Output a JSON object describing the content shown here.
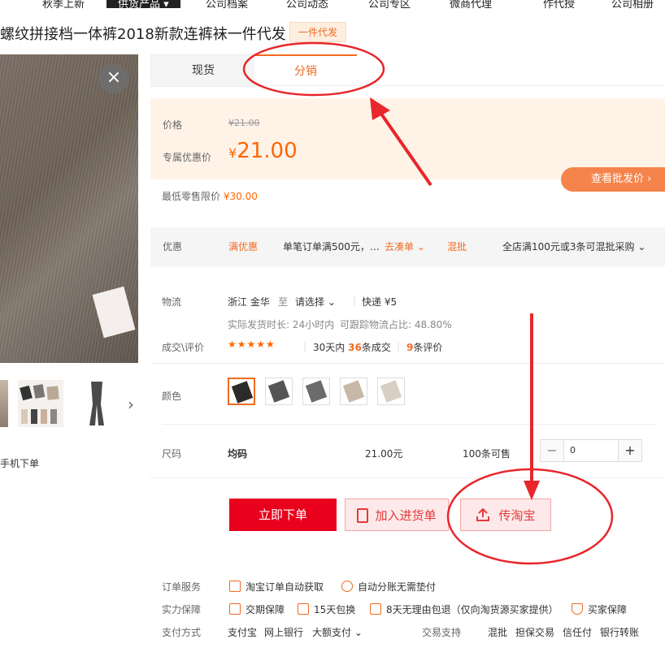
{
  "nav": {
    "items": [
      "秋季上新",
      "供货产品 ▾",
      "公司档案",
      "公司动态",
      "公司专区",
      "微商代理",
      "作代授",
      "公司相册"
    ]
  },
  "product": {
    "title": "螺纹拼接档一体裤2018新款连裤袜一件代发",
    "badge": "一件代发"
  },
  "gallery": {
    "close_symbol": "×",
    "mobile_order": "手机下单"
  },
  "tabs": {
    "spot": "现货",
    "distribution": "分销"
  },
  "price": {
    "price_label": "价格",
    "original": "¥21.00",
    "exclusive_label": "专属优惠价",
    "currency": "¥",
    "exclusive": "21.00",
    "view_wholesale": "查看批发价 ›",
    "min_retail_label": "最低零售限价",
    "min_retail": "¥30.00"
  },
  "promo": {
    "label": "优惠",
    "tag": "满优惠",
    "detail": "单笔订单满500元，…",
    "go_order": "去凑单 ⌄",
    "mix_tag": "混批",
    "mix_detail": "全店满100元或3条可混批采购 ⌄"
  },
  "logistics": {
    "label": "物流",
    "origin": "浙江 金华",
    "to": "至",
    "select": "请选择 ⌄",
    "express": "快递 ¥5",
    "ship_time": "实际发货时长: 24小时内",
    "trace_rate": "可跟踪物流占比: 48.80%"
  },
  "deals": {
    "label": "成交\\评价",
    "stars": "★★★★★",
    "days_prefix": "30天内",
    "deal_count": "36",
    "deal_suffix": "条成交",
    "review_count": "9",
    "review_suffix": "条评价"
  },
  "color": {
    "label": "颜色",
    "swatches": [
      "#2b2b2b",
      "#555555",
      "#6b6b6b",
      "#c8b8a8",
      "#d8cfc4"
    ]
  },
  "size": {
    "label": "尺码",
    "value": "均码",
    "price": "21.00元",
    "stock": "100条可售",
    "qty": "0",
    "minus": "−",
    "plus": "+"
  },
  "actions": {
    "order": "立即下单",
    "cart": "加入进货单",
    "taobao": "传淘宝"
  },
  "services": {
    "order_label": "订单服务",
    "order_1": "淘宝订单自动获取",
    "order_2": "自动分账无需垫付",
    "power_label": "实力保障",
    "power_1": "交期保障",
    "power_2": "15天包换",
    "power_3": "8天无理由包退（仅向淘货源买家提供）",
    "power_4": "买家保障",
    "pay_label": "支付方式",
    "pay_1": "支付宝",
    "pay_2": "网上银行",
    "pay_3": "大额支付 ⌄",
    "trade_label": "交易支持",
    "trade_1": "混批",
    "trade_2": "担保交易",
    "trade_3": "信任付",
    "trade_4": "银行转账"
  },
  "colors": {
    "accent": "#f26a21",
    "red": "#e8001c",
    "annotation": "#e8262b"
  }
}
